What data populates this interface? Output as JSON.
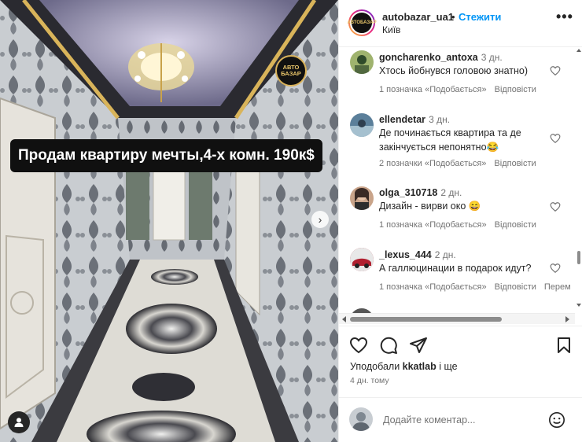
{
  "post": {
    "caption": "Продам квартиру мечты,4-х комн. 190к$",
    "watermark_top": "АВТО",
    "watermark_bottom": "БАЗАР",
    "next_glyph": "›"
  },
  "header": {
    "username": "autobazar_ua1",
    "separator": "•",
    "follow_label": "Стежити",
    "location": "Київ",
    "more_glyph": "•••",
    "avatar_text": "АВТОБАЗАР"
  },
  "comments": [
    {
      "user": "goncharenko_antoxa",
      "time": "3 дн.",
      "text": "Хтось йобнувся головою знатно)",
      "likes": "1 позначка «Подобається»",
      "reply": "Відповісти",
      "avatar_color": "#9fb36e"
    },
    {
      "user": "ellendetar",
      "time": "3 дн.",
      "text": "Де починається квартира та де закінчується непонятно😂",
      "likes": "2 позначки «Подобається»",
      "reply": "Відповісти",
      "avatar_color": "#5b7f9a"
    },
    {
      "user": "olga_310718",
      "time": "2 дн.",
      "text": "Дизайн - вирви око 😄",
      "likes": "1 позначка «Подобається»",
      "reply": "Відповісти",
      "avatar_color": "#c9a48a"
    },
    {
      "user": "_lexus_444",
      "time": "2 дн.",
      "text": "А галлюцинации в подарок идут?",
      "likes": "1 позначка «Подобається»",
      "reply": "Відповісти",
      "extra": "Перем",
      "avatar_color": "#b02030"
    }
  ],
  "footer": {
    "liked_prefix": "Уподобали",
    "liked_user": "kkatlab",
    "liked_suffix": "і ще",
    "post_time": "4 дн. тому",
    "comment_placeholder": "Додайте коментар..."
  },
  "icons": {
    "like": "heart-icon",
    "comment": "comment-icon",
    "share": "send-icon",
    "save": "bookmark-icon",
    "emoji": "smiley-icon",
    "tag": "person-icon"
  },
  "colors": {
    "follow": "#0095f6",
    "muted": "#737373",
    "text": "#262626",
    "caption_bg": "#101010"
  }
}
